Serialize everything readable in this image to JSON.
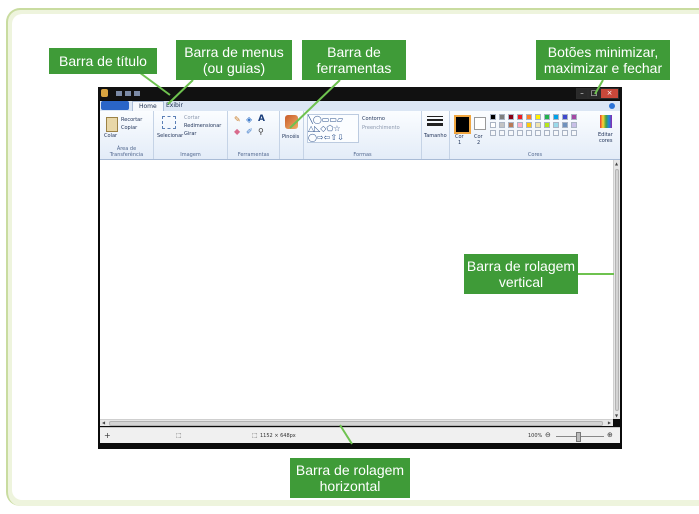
{
  "callouts": {
    "title_bar": "Barra de título",
    "menu_bar_line1": "Barra de menus",
    "menu_bar_line2": "(ou guias)",
    "toolbar_line1": "Barra de",
    "toolbar_line2": "ferramentas",
    "window_buttons_line1": "Botões minimizar,",
    "window_buttons_line2": "maximizar e fechar",
    "vscroll_line1": "Barra de rolagem",
    "vscroll_line2": "vertical",
    "hscroll_line1": "Barra de rolagem",
    "hscroll_line2": "horizontal"
  },
  "paint": {
    "tabs": {
      "home": "Home",
      "view": "Exibir"
    },
    "clipboard": {
      "paste": "Colar",
      "cut": "Recortar",
      "copy": "Copiar",
      "group": "Área de Transferência"
    },
    "image": {
      "select": "Selecionar",
      "crop": "Cortar",
      "resize": "Redimensionar",
      "rotate": "Girar",
      "group": "Imagem"
    },
    "tools": {
      "group": "Ferramentas"
    },
    "brushes": {
      "label": "Pincéis"
    },
    "shapes": {
      "outline": "Contorno",
      "fill": "Preenchimento",
      "group": "Formas"
    },
    "size": {
      "label": "Tamanho"
    },
    "colors": {
      "color1": "Cor",
      "color1_n": "1",
      "color2": "Cor",
      "color2_n": "2",
      "edit": "Editar",
      "edit2": "cores",
      "group": "Cores"
    },
    "status": {
      "dimensions": "1152 × 648px",
      "zoom": "100%"
    }
  },
  "palette": [
    "#000000",
    "#7f7f7f",
    "#880015",
    "#ed1c24",
    "#ff7f27",
    "#fff200",
    "#22b14c",
    "#00a2e8",
    "#3f48cc",
    "#a349a4",
    "#ffffff",
    "#c3c3c3",
    "#b97a57",
    "#ffaec9",
    "#ffc90e",
    "#efe4b0",
    "#b5e61d",
    "#99d9ea",
    "#7092be",
    "#c8bfe7"
  ],
  "colors": {
    "callout_bg": "#3f9b38",
    "frame_bg": "#eef4dd",
    "callout_line": "#6ec24f"
  }
}
